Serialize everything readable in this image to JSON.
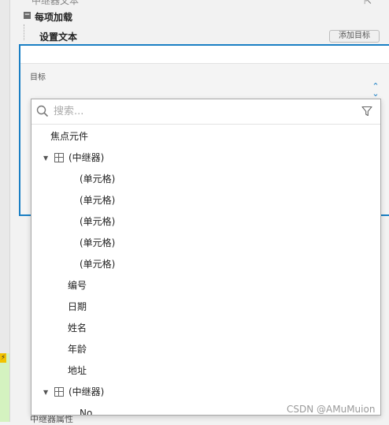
{
  "properties": {
    "cut_top_text": "中继器文本",
    "section_title": "每项加载",
    "action_label": "设置文本",
    "add_target_label": "添加目标",
    "target_label": "目标",
    "cut_bottom_text": "中继器属性"
  },
  "dropdown": {
    "search_placeholder": "搜索...",
    "items": [
      {
        "label": "焦点元件"
      },
      {
        "label": "(中继器)"
      },
      {
        "label": "(单元格)"
      },
      {
        "label": "(单元格)"
      },
      {
        "label": "(单元格)"
      },
      {
        "label": "(单元格)"
      },
      {
        "label": "(单元格)"
      },
      {
        "label": "编号"
      },
      {
        "label": "日期"
      },
      {
        "label": "姓名"
      },
      {
        "label": "年龄"
      },
      {
        "label": "地址"
      },
      {
        "label": "(中继器)"
      },
      {
        "label": "No"
      }
    ]
  },
  "watermark": "CSDN @AMuMuion",
  "colors": {
    "accent": "#1a7fc4",
    "highlight_green": "#d4f2c0"
  }
}
